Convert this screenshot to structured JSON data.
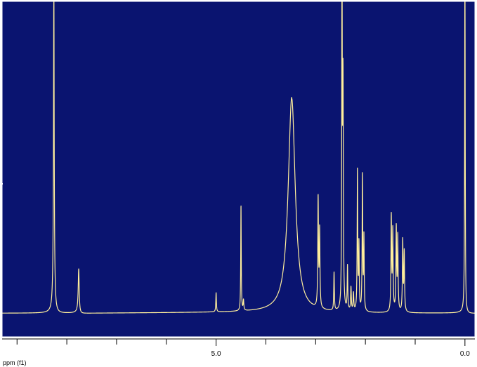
{
  "colors": {
    "plot_background": "#0a1470",
    "trace": "#ffef9c",
    "frame": "#ffffff",
    "axis_background": "#ffffff",
    "axis_text": "#000000"
  },
  "axis": {
    "label": "ppm (f1)"
  },
  "chart_data": {
    "type": "line",
    "title": "",
    "xlabel": "ppm (f1)",
    "ylabel": "",
    "x_reversed": true,
    "xlim": [
      9.3,
      -0.2
    ],
    "ylim": [
      -0.08,
      1.06
    ],
    "grid": false,
    "x_ticks": [
      {
        "value": 5.0,
        "label": "5.0"
      },
      {
        "value": 0.0,
        "label": "0.0"
      }
    ],
    "x_minor_ticks": [
      9.0,
      8.0,
      7.0,
      6.0,
      4.0,
      3.0,
      2.0,
      1.0
    ],
    "baseline": 0.0,
    "peaks": [
      {
        "ppm": 8.26,
        "height": 0.82,
        "width": 0.006,
        "shape": "dispersive",
        "dip": 0.035
      },
      {
        "ppm": 8.26,
        "height": 0.36,
        "width": 0.015
      },
      {
        "ppm": 7.76,
        "height": 0.15,
        "width": 0.012,
        "shape": "dispersive",
        "dip": 0.015
      },
      {
        "ppm": 5.0,
        "height": 0.065,
        "width": 0.007
      },
      {
        "ppm": 4.5,
        "height": 0.36,
        "width": 0.006
      },
      {
        "ppm": 4.45,
        "height": 0.035,
        "width": 0.008
      },
      {
        "ppm": 3.48,
        "height": 0.73,
        "width": 0.085
      },
      {
        "ppm": 2.95,
        "height": 0.37,
        "width": 0.008
      },
      {
        "ppm": 2.92,
        "height": 0.26,
        "width": 0.008
      },
      {
        "ppm": 2.63,
        "height": 0.13,
        "width": 0.007
      },
      {
        "ppm": 2.47,
        "height": 1.3,
        "width": 0.006
      },
      {
        "ppm": 2.45,
        "height": 0.75,
        "width": 0.008
      },
      {
        "ppm": 2.36,
        "height": 0.15,
        "width": 0.007
      },
      {
        "ppm": 2.29,
        "height": 0.08,
        "width": 0.008
      },
      {
        "ppm": 2.24,
        "height": 0.06,
        "width": 0.008
      },
      {
        "ppm": 2.16,
        "height": 0.48,
        "width": 0.007
      },
      {
        "ppm": 2.13,
        "height": 0.22,
        "width": 0.007
      },
      {
        "ppm": 2.06,
        "height": 0.46,
        "width": 0.007
      },
      {
        "ppm": 2.03,
        "height": 0.25,
        "width": 0.007
      },
      {
        "ppm": 1.48,
        "height": 0.32,
        "width": 0.008
      },
      {
        "ppm": 1.45,
        "height": 0.27,
        "width": 0.008
      },
      {
        "ppm": 1.38,
        "height": 0.28,
        "width": 0.008
      },
      {
        "ppm": 1.35,
        "height": 0.25,
        "width": 0.008
      },
      {
        "ppm": 1.25,
        "height": 0.24,
        "width": 0.008
      },
      {
        "ppm": 1.22,
        "height": 0.2,
        "width": 0.008
      },
      {
        "ppm": 0.0,
        "height": 1.3,
        "width": 0.006,
        "shape": "dispersive",
        "dip": 0.04
      }
    ]
  }
}
